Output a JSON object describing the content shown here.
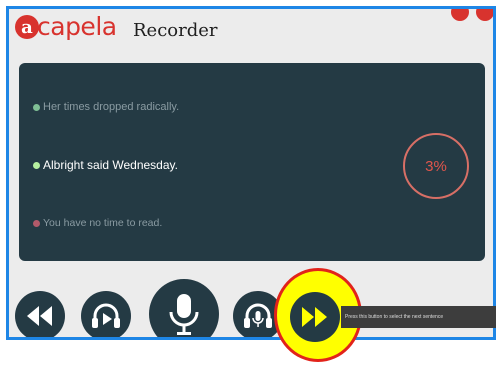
{
  "app": {
    "logo_letter": "a",
    "logo_rest": "capela",
    "title": "Recorder"
  },
  "sentences": [
    {
      "text": "Her times dropped radically.",
      "state": "done"
    },
    {
      "text": "Albright said Wednesday.",
      "state": "current"
    },
    {
      "text": "You have no time to read.",
      "state": "pending"
    }
  ],
  "progress": {
    "label": "3%",
    "value": 0.03
  },
  "controls": {
    "rewind": "rewind-icon",
    "listen": "headphones-play-icon",
    "record": "microphone-icon",
    "playback": "headphones-mic-icon",
    "next": "fast-forward-icon"
  },
  "tooltip": {
    "text": "Press this button to select the next sentence"
  },
  "colors": {
    "brand": "#d8332e",
    "panel": "#243a44",
    "window_border": "#1e86e6",
    "highlight": "#ffff00",
    "highlight_border": "#e2231a"
  }
}
